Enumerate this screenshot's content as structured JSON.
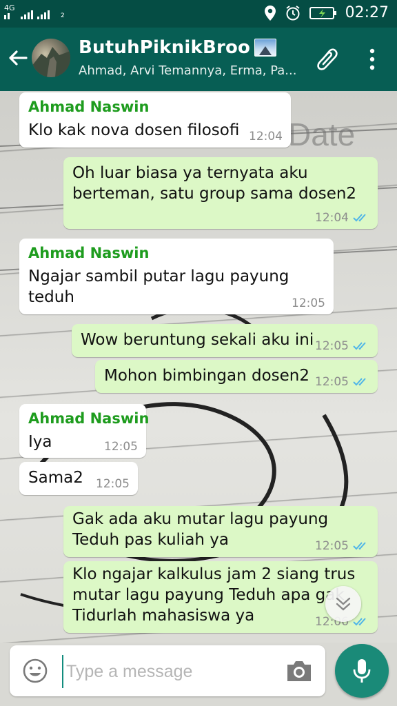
{
  "status_bar": {
    "network_label": "4G",
    "sim_label": "2",
    "time": "02:27"
  },
  "header": {
    "title": "ButuhPiknikBroo",
    "title_emoji": "mount-fuji-emoji",
    "subtitle": "Ahmad, Arvi Temannya, Erma, Pa..."
  },
  "messages": [
    {
      "sender": "Ahmad Naswin",
      "text": "Klo kak nova dosen filosofi",
      "time": "12:04"
    },
    {
      "text": "Oh luar biasa ya ternyata aku berteman, satu group sama dosen2",
      "time": "12:04",
      "read": true
    },
    {
      "sender": "Ahmad Naswin",
      "text": "Ngajar sambil putar lagu payung teduh",
      "time": "12:05"
    },
    {
      "text": "Wow beruntung sekali aku ini",
      "time": "12:05",
      "read": true
    },
    {
      "text": "Mohon bimbingan dosen2",
      "time": "12:05",
      "read": true
    },
    {
      "sender": "Ahmad Naswin",
      "text": "Iya",
      "time": "12:05"
    },
    {
      "text": "Sama2",
      "time": "12:05"
    },
    {
      "text": "Gak ada aku mutar lagu payung Teduh pas kuliah ya",
      "time": "12:05",
      "read": true
    },
    {
      "text": "Klo ngajar kalkulus jam 2 siang trus mutar lagu payung Teduh apa gak Tidurlah mahasiswa ya",
      "time": "12:06",
      "read": true
    }
  ],
  "wallpaper_text": "Date",
  "input": {
    "placeholder": "Type a message",
    "value": ""
  },
  "colors": {
    "header": "#075e54",
    "status_bar": "#054d44",
    "outgoing_bubble": "#dcf8c6",
    "incoming_bubble": "#ffffff",
    "sender_name": "#1e9c1e",
    "read_ticks": "#4fb5e8",
    "mic_button": "#1a8a78"
  }
}
